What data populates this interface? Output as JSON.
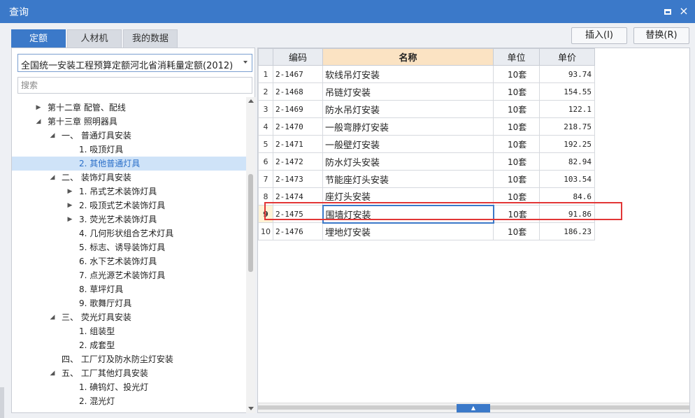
{
  "window": {
    "title": "查询",
    "maximize_glyph": "□",
    "close_glyph": "×"
  },
  "tabs": [
    {
      "label": "定额",
      "active": true
    },
    {
      "label": "人材机",
      "active": false
    },
    {
      "label": "我的数据",
      "active": false
    }
  ],
  "actions": {
    "insert_label": "插入(I)",
    "replace_label": "替换(R)"
  },
  "library_select": {
    "value": "全国统一安装工程预算定额河北省消耗量定额(2012)"
  },
  "search": {
    "placeholder": "搜索",
    "value": ""
  },
  "tree": {
    "items": [
      {
        "label": "第十二章 配管、配线",
        "toggle": "▶",
        "indent": 0
      },
      {
        "label": "第十三章 照明器具",
        "toggle": "◢",
        "indent": 0
      },
      {
        "label": "一、 普通灯具安装",
        "toggle": "◢",
        "indent": 1
      },
      {
        "label": "1. 吸顶灯具",
        "toggle": "",
        "indent": 2
      },
      {
        "label": "2. 其他普通灯具",
        "toggle": "",
        "indent": 2,
        "selected": true
      },
      {
        "label": "二、 装饰灯具安装",
        "toggle": "◢",
        "indent": 1
      },
      {
        "label": "1. 吊式艺术装饰灯具",
        "toggle": "▶",
        "indent": 2
      },
      {
        "label": "2. 吸顶式艺术装饰灯具",
        "toggle": "▶",
        "indent": 2
      },
      {
        "label": "3. 荧光艺术装饰灯具",
        "toggle": "▶",
        "indent": 2
      },
      {
        "label": "4. 几何形状组合艺术灯具",
        "toggle": "",
        "indent": 2
      },
      {
        "label": "5. 标志、诱导装饰灯具",
        "toggle": "",
        "indent": 2
      },
      {
        "label": "6. 水下艺术装饰灯具",
        "toggle": "",
        "indent": 2
      },
      {
        "label": "7. 点光源艺术装饰灯具",
        "toggle": "",
        "indent": 2
      },
      {
        "label": "8. 草坪灯具",
        "toggle": "",
        "indent": 2
      },
      {
        "label": "9. 歌舞厅灯具",
        "toggle": "",
        "indent": 2
      },
      {
        "label": "三、 荧光灯具安装",
        "toggle": "◢",
        "indent": 1
      },
      {
        "label": "1. 组装型",
        "toggle": "",
        "indent": 2
      },
      {
        "label": "2. 成套型",
        "toggle": "",
        "indent": 2
      },
      {
        "label": "四、 工厂灯及防水防尘灯安装",
        "toggle": "",
        "indent": 1
      },
      {
        "label": "五、 工厂其他灯具安装",
        "toggle": "◢",
        "indent": 1
      },
      {
        "label": "1. 碘钨灯、投光灯",
        "toggle": "",
        "indent": 2
      },
      {
        "label": "2. 混光灯",
        "toggle": "",
        "indent": 2
      }
    ]
  },
  "table": {
    "headers": {
      "index": "",
      "code": "编码",
      "name": "名称",
      "unit": "单位",
      "price": "单价"
    },
    "rows": [
      {
        "index": "1",
        "code": "2-1467",
        "name": "软线吊灯安装",
        "unit": "10套",
        "price": "93.74"
      },
      {
        "index": "2",
        "code": "2-1468",
        "name": "吊链灯安装",
        "unit": "10套",
        "price": "154.55"
      },
      {
        "index": "3",
        "code": "2-1469",
        "name": "防水吊灯安装",
        "unit": "10套",
        "price": "122.1"
      },
      {
        "index": "4",
        "code": "2-1470",
        "name": "一般弯脖灯安装",
        "unit": "10套",
        "price": "218.75"
      },
      {
        "index": "5",
        "code": "2-1471",
        "name": "一般壁灯安装",
        "unit": "10套",
        "price": "192.25"
      },
      {
        "index": "6",
        "code": "2-1472",
        "name": "防水灯头安装",
        "unit": "10套",
        "price": "82.94"
      },
      {
        "index": "7",
        "code": "2-1473",
        "name": "节能座灯头安装",
        "unit": "10套",
        "price": "103.54"
      },
      {
        "index": "8",
        "code": "2-1474",
        "name": "座灯头安装",
        "unit": "10套",
        "price": "84.6"
      },
      {
        "index": "9",
        "code": "2-1475",
        "name": "围墙灯安装",
        "unit": "10套",
        "price": "91.86",
        "current": true
      },
      {
        "index": "10",
        "code": "2-1476",
        "name": "埋地灯安装",
        "unit": "10套",
        "price": "186.23"
      }
    ]
  },
  "splitter": {
    "glyph": "▲"
  },
  "colors": {
    "accent": "#3b79c9",
    "highlight": "#e23636",
    "selected_row": "#cfe3f8",
    "name_header": "#fbe3c3"
  }
}
